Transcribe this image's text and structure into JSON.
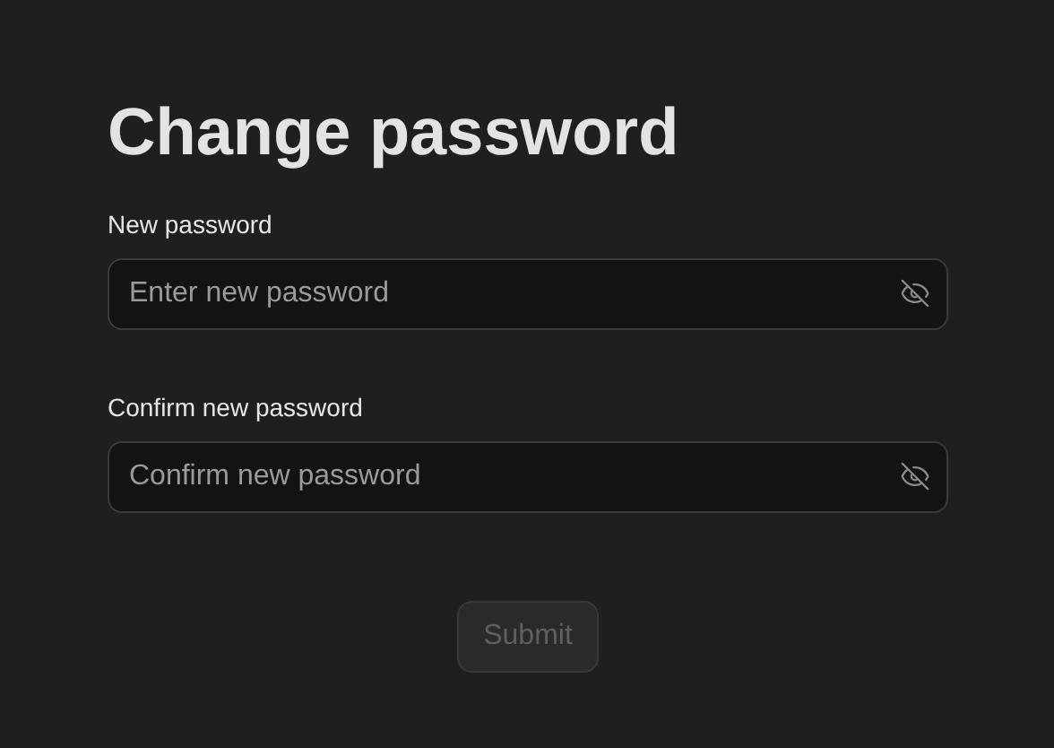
{
  "title": "Change password",
  "fields": [
    {
      "label": "New password",
      "placeholder": "Enter new password"
    },
    {
      "label": "Confirm new password",
      "placeholder": "Confirm new password"
    }
  ],
  "submit": {
    "label": "Submit",
    "disabled": true
  }
}
